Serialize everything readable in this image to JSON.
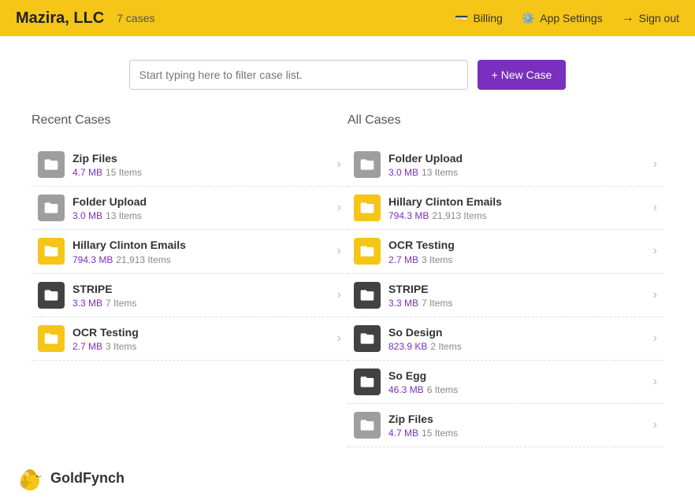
{
  "header": {
    "brand": "Mazira, LLC",
    "caseCount": "7 cases",
    "nav": {
      "billing": "Billing",
      "appSettings": "App Settings",
      "signOut": "Sign out"
    }
  },
  "search": {
    "placeholder": "Start typing here to filter case list.",
    "newCaseBtn": "+ New Case"
  },
  "recentCases": {
    "heading": "Recent Cases",
    "items": [
      {
        "name": "Zip Files",
        "size": "4.7 MB",
        "count": "15 Items",
        "iconColor": "gray"
      },
      {
        "name": "Folder Upload",
        "size": "3.0 MB",
        "count": "13 Items",
        "iconColor": "gray"
      },
      {
        "name": "Hillary Clinton Emails",
        "size": "794.3 MB",
        "count": "21,913 Items",
        "iconColor": "yellow"
      },
      {
        "name": "STRIPE",
        "size": "3.3 MB",
        "count": "7 Items",
        "iconColor": "dark"
      },
      {
        "name": "OCR Testing",
        "size": "2.7 MB",
        "count": "3 Items",
        "iconColor": "yellow"
      }
    ]
  },
  "allCases": {
    "heading": "All Cases",
    "items": [
      {
        "name": "Folder Upload",
        "size": "3.0 MB",
        "count": "13 Items",
        "iconColor": "gray"
      },
      {
        "name": "Hillary Clinton Emails",
        "size": "794.3 MB",
        "count": "21,913 Items",
        "iconColor": "yellow"
      },
      {
        "name": "OCR Testing",
        "size": "2.7 MB",
        "count": "3 Items",
        "iconColor": "yellow"
      },
      {
        "name": "STRIPE",
        "size": "3.3 MB",
        "count": "7 Items",
        "iconColor": "dark"
      },
      {
        "name": "So Design",
        "size": "823.9 KB",
        "count": "2 Items",
        "iconColor": "dark"
      },
      {
        "name": "So Egg",
        "size": "46.3 MB",
        "count": "6 Items",
        "iconColor": "dark"
      },
      {
        "name": "Zip Files",
        "size": "4.7 MB",
        "count": "15 Items",
        "iconColor": "gray"
      }
    ]
  },
  "footer": {
    "brand": "GoldFynch"
  }
}
